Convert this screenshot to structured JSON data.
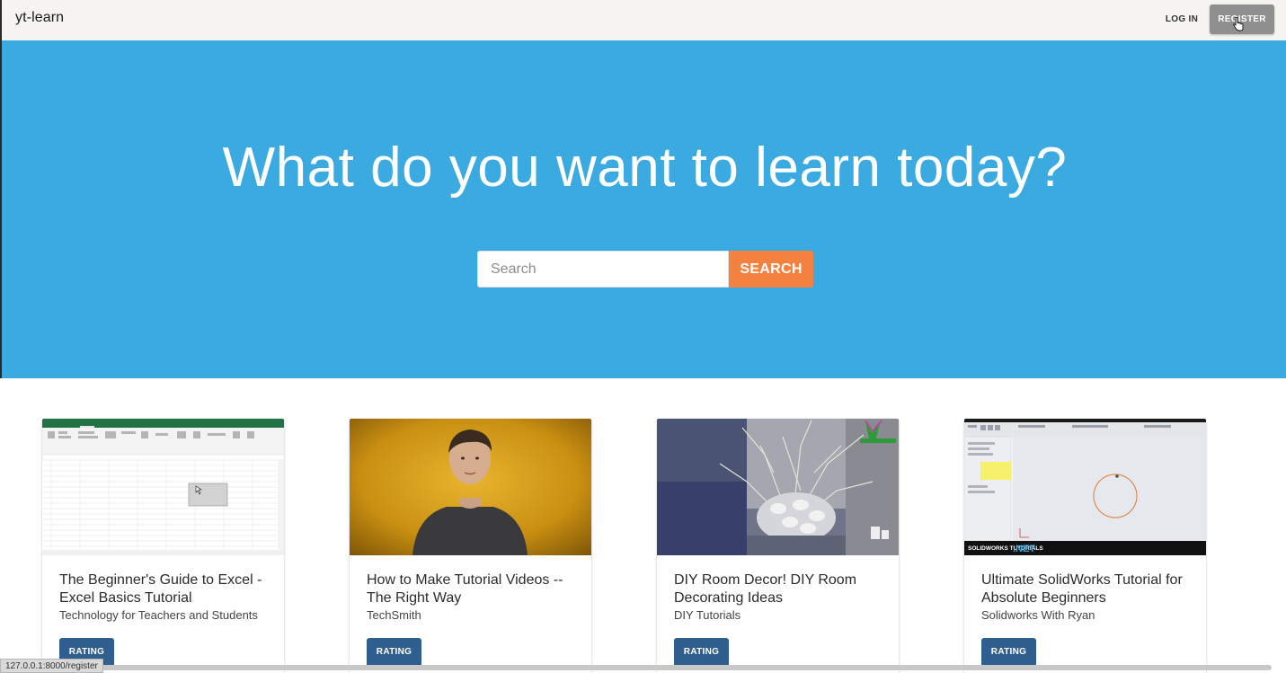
{
  "nav": {
    "brand": "yt-learn",
    "login_label": "LOG IN",
    "register_label": "REGISTER"
  },
  "hero": {
    "title": "What do you want to learn today?",
    "search_placeholder": "Search",
    "search_button": "SEARCH",
    "background_color": "#3aaae1",
    "accent_color": "#f4813f"
  },
  "videos": [
    {
      "title": "The Beginner's Guide to Excel - Excel Basics Tutorial",
      "channel": "Technology for Teachers and Students",
      "rating_label": "RATING",
      "thumbnail": "excel-spreadsheet-thumbnail"
    },
    {
      "title": "How to Make Tutorial Videos -- The Right Way",
      "channel": "TechSmith",
      "rating_label": "RATING",
      "thumbnail": "presenter-yellow-background-thumbnail"
    },
    {
      "title": "DIY Room Decor! DIY Room Decorating Ideas",
      "channel": "DIY Tutorials",
      "rating_label": "RATING",
      "thumbnail": "decor-branches-vase-thumbnail"
    },
    {
      "title": "Ultimate SolidWorks Tutorial for Absolute Beginners",
      "channel": "Solidworks With Ryan",
      "rating_label": "RATING",
      "thumbnail": "solidworks-sketch-thumbnail",
      "thumbnail_caption_a": "SOLIDWORKS TUTORIALS",
      "thumbnail_caption_b": ".NET"
    }
  ],
  "status_bar": {
    "url": "127.0.0.1:8000/register"
  }
}
